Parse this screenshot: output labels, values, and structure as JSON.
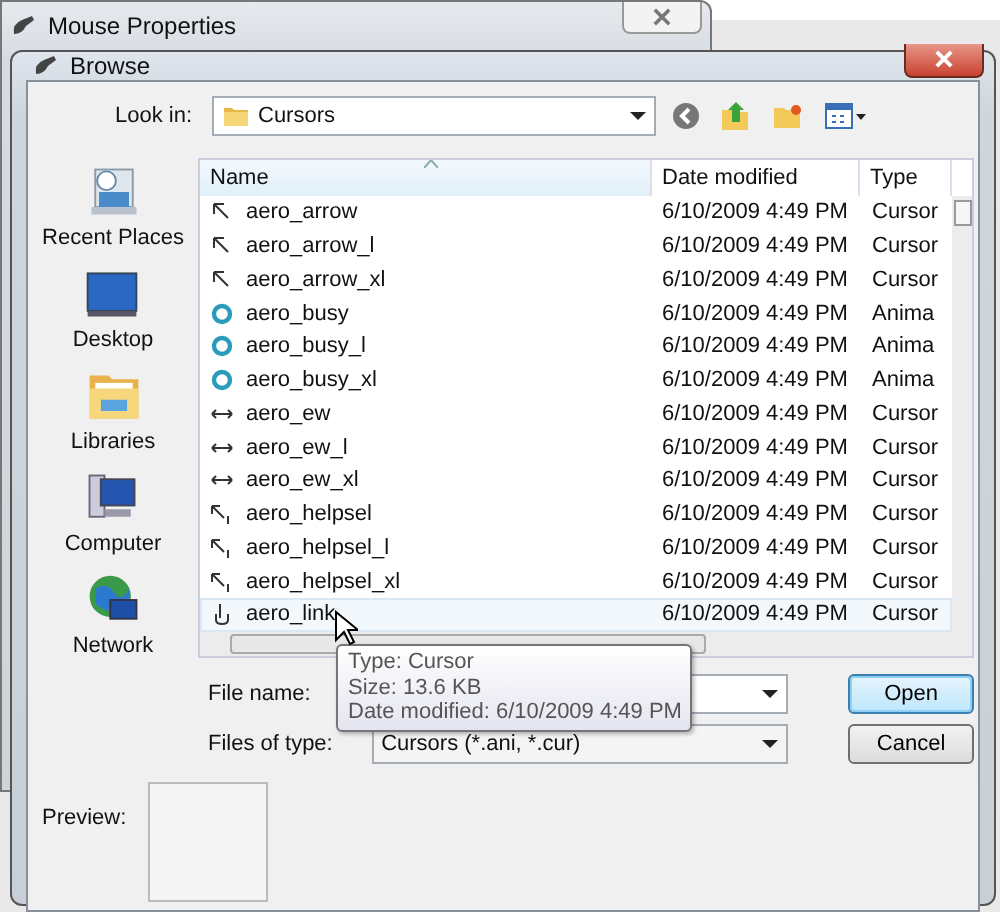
{
  "background_window": {
    "title": "Mouse Properties"
  },
  "dialog": {
    "title": "Browse"
  },
  "look_in": {
    "label": "Look in:",
    "value": "Cursors"
  },
  "places": [
    {
      "label": "Recent Places",
      "kind": "recent"
    },
    {
      "label": "Desktop",
      "kind": "desktop"
    },
    {
      "label": "Libraries",
      "kind": "libraries"
    },
    {
      "label": "Computer",
      "kind": "computer"
    },
    {
      "label": "Network",
      "kind": "network"
    }
  ],
  "columns": [
    {
      "label": "Name",
      "sorted": true
    },
    {
      "label": "Date modified",
      "sorted": false
    },
    {
      "label": "Type",
      "sorted": false
    }
  ],
  "files": [
    {
      "name": "aero_arrow",
      "date": "6/10/2009 4:49 PM",
      "type": "Cursor",
      "kind": "arrow",
      "hovered": false
    },
    {
      "name": "aero_arrow_l",
      "date": "6/10/2009 4:49 PM",
      "type": "Cursor",
      "kind": "arrow",
      "hovered": false
    },
    {
      "name": "aero_arrow_xl",
      "date": "6/10/2009 4:49 PM",
      "type": "Cursor",
      "kind": "arrow",
      "hovered": false
    },
    {
      "name": "aero_busy",
      "date": "6/10/2009 4:49 PM",
      "type": "Anima",
      "kind": "busy",
      "hovered": false
    },
    {
      "name": "aero_busy_l",
      "date": "6/10/2009 4:49 PM",
      "type": "Anima",
      "kind": "busy",
      "hovered": false
    },
    {
      "name": "aero_busy_xl",
      "date": "6/10/2009 4:49 PM",
      "type": "Anima",
      "kind": "busy",
      "hovered": false
    },
    {
      "name": "aero_ew",
      "date": "6/10/2009 4:49 PM",
      "type": "Cursor",
      "kind": "ew",
      "hovered": false
    },
    {
      "name": "aero_ew_l",
      "date": "6/10/2009 4:49 PM",
      "type": "Cursor",
      "kind": "ew",
      "hovered": false
    },
    {
      "name": "aero_ew_xl",
      "date": "6/10/2009 4:49 PM",
      "type": "Cursor",
      "kind": "ew",
      "hovered": false
    },
    {
      "name": "aero_helpsel",
      "date": "6/10/2009 4:49 PM",
      "type": "Cursor",
      "kind": "helpsel",
      "hovered": false
    },
    {
      "name": "aero_helpsel_l",
      "date": "6/10/2009 4:49 PM",
      "type": "Cursor",
      "kind": "helpsel",
      "hovered": false
    },
    {
      "name": "aero_helpsel_xl",
      "date": "6/10/2009 4:49 PM",
      "type": "Cursor",
      "kind": "helpsel",
      "hovered": false
    },
    {
      "name": "aero_link",
      "date": "6/10/2009 4:49 PM",
      "type": "Cursor",
      "kind": "link",
      "hovered": true
    }
  ],
  "file_name": {
    "label": "File name:"
  },
  "files_of_type": {
    "label": "Files of type:",
    "value": "Cursors (*.ani, *.cur)"
  },
  "buttons": [
    {
      "label": "Open",
      "default": true
    },
    {
      "label": "Cancel",
      "default": false
    }
  ],
  "tooltip": [
    "Type: Cursor",
    "Size: 13.6 KB",
    "Date modified: 6/10/2009 4:49 PM"
  ],
  "preview": {
    "label": "Preview:"
  }
}
